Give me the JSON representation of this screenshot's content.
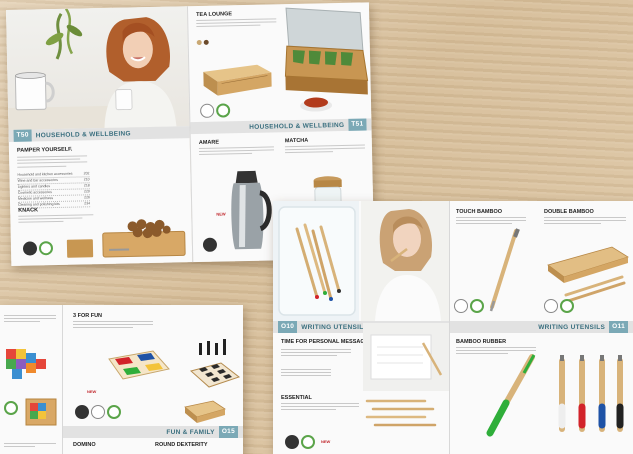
{
  "b1": {
    "left_title": "HOUSEHOLD & WELLBEING",
    "left_num": "T50",
    "right_title": "HOUSEHOLD & WELLBEING",
    "right_num": "T51",
    "intro_heading": "PAMPER YOURSELF.",
    "legend": [
      {
        "label": "Household and kitchen accessories",
        "page": "202"
      },
      {
        "label": "Wine and bar accessories",
        "page": "210"
      },
      {
        "label": "Lighters and candles",
        "page": "218"
      },
      {
        "label": "Cosmetic accessories",
        "page": "220"
      },
      {
        "label": "Medicine and wellness",
        "page": "226"
      },
      {
        "label": "Cleaning and polishing kits",
        "page": "234"
      }
    ],
    "knack": "KNACK",
    "tea_lounge": "TEA LOUNGE",
    "amare": "AMARE",
    "matcha": "MATCHA",
    "new_label": "NEW"
  },
  "b2": {
    "left_num": "O10",
    "left_title": "WRITING UTENSILS",
    "right_title": "WRITING UTENSILS",
    "right_num": "O11",
    "headline": "TIME FOR PERSONAL MESSAGES.",
    "essential": "ESSENTIAL",
    "touch": "TOUCH BAMBOO",
    "double": "DOUBLE BAMBOO",
    "rubber": "BAMBOO RUBBER",
    "new_label": "NEW"
  },
  "b3": {
    "title": "3 FOR FUN",
    "bar_title": "FUN & FAMILY",
    "bar_num": "O15",
    "domino": "DOMINO",
    "dexterity": "ROUND DEXTERITY",
    "new_label": "NEW"
  },
  "colors": {
    "teal": "#3a6f7f",
    "green_badge": "#5aa449",
    "pen_green": "#2fae3a",
    "pen_red": "#d2232a",
    "pen_blue": "#1e52a6"
  }
}
